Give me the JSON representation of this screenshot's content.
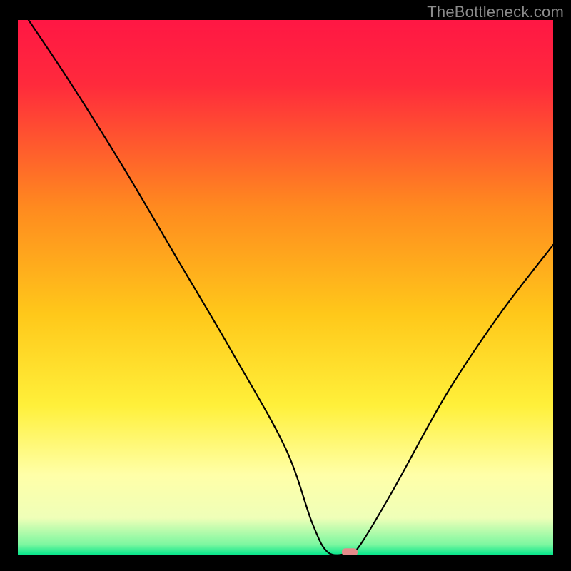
{
  "watermark": "TheBottleneck.com",
  "chart_data": {
    "type": "line",
    "title": "",
    "xlabel": "",
    "ylabel": "",
    "xlim": [
      0,
      100
    ],
    "ylim": [
      0,
      100
    ],
    "series": [
      {
        "name": "bottleneck-curve",
        "x": [
          2,
          10,
          20,
          30,
          40,
          50,
          55,
          58,
          62,
          64,
          70,
          80,
          90,
          100
        ],
        "y": [
          100,
          88,
          72,
          55,
          38,
          20,
          6,
          0.5,
          0.5,
          2,
          12,
          30,
          45,
          58
        ]
      }
    ],
    "marker": {
      "x": 62,
      "y": 0.5
    },
    "gradient_stops": [
      {
        "pct": 0,
        "color": "#FF1744"
      },
      {
        "pct": 12,
        "color": "#FF2A3C"
      },
      {
        "pct": 35,
        "color": "#FF8A1F"
      },
      {
        "pct": 55,
        "color": "#FFC81A"
      },
      {
        "pct": 72,
        "color": "#FFF03A"
      },
      {
        "pct": 85,
        "color": "#FFFFA8"
      },
      {
        "pct": 93,
        "color": "#EFFFB8"
      },
      {
        "pct": 98,
        "color": "#7CF7A0"
      },
      {
        "pct": 100,
        "color": "#00E58A"
      }
    ]
  }
}
